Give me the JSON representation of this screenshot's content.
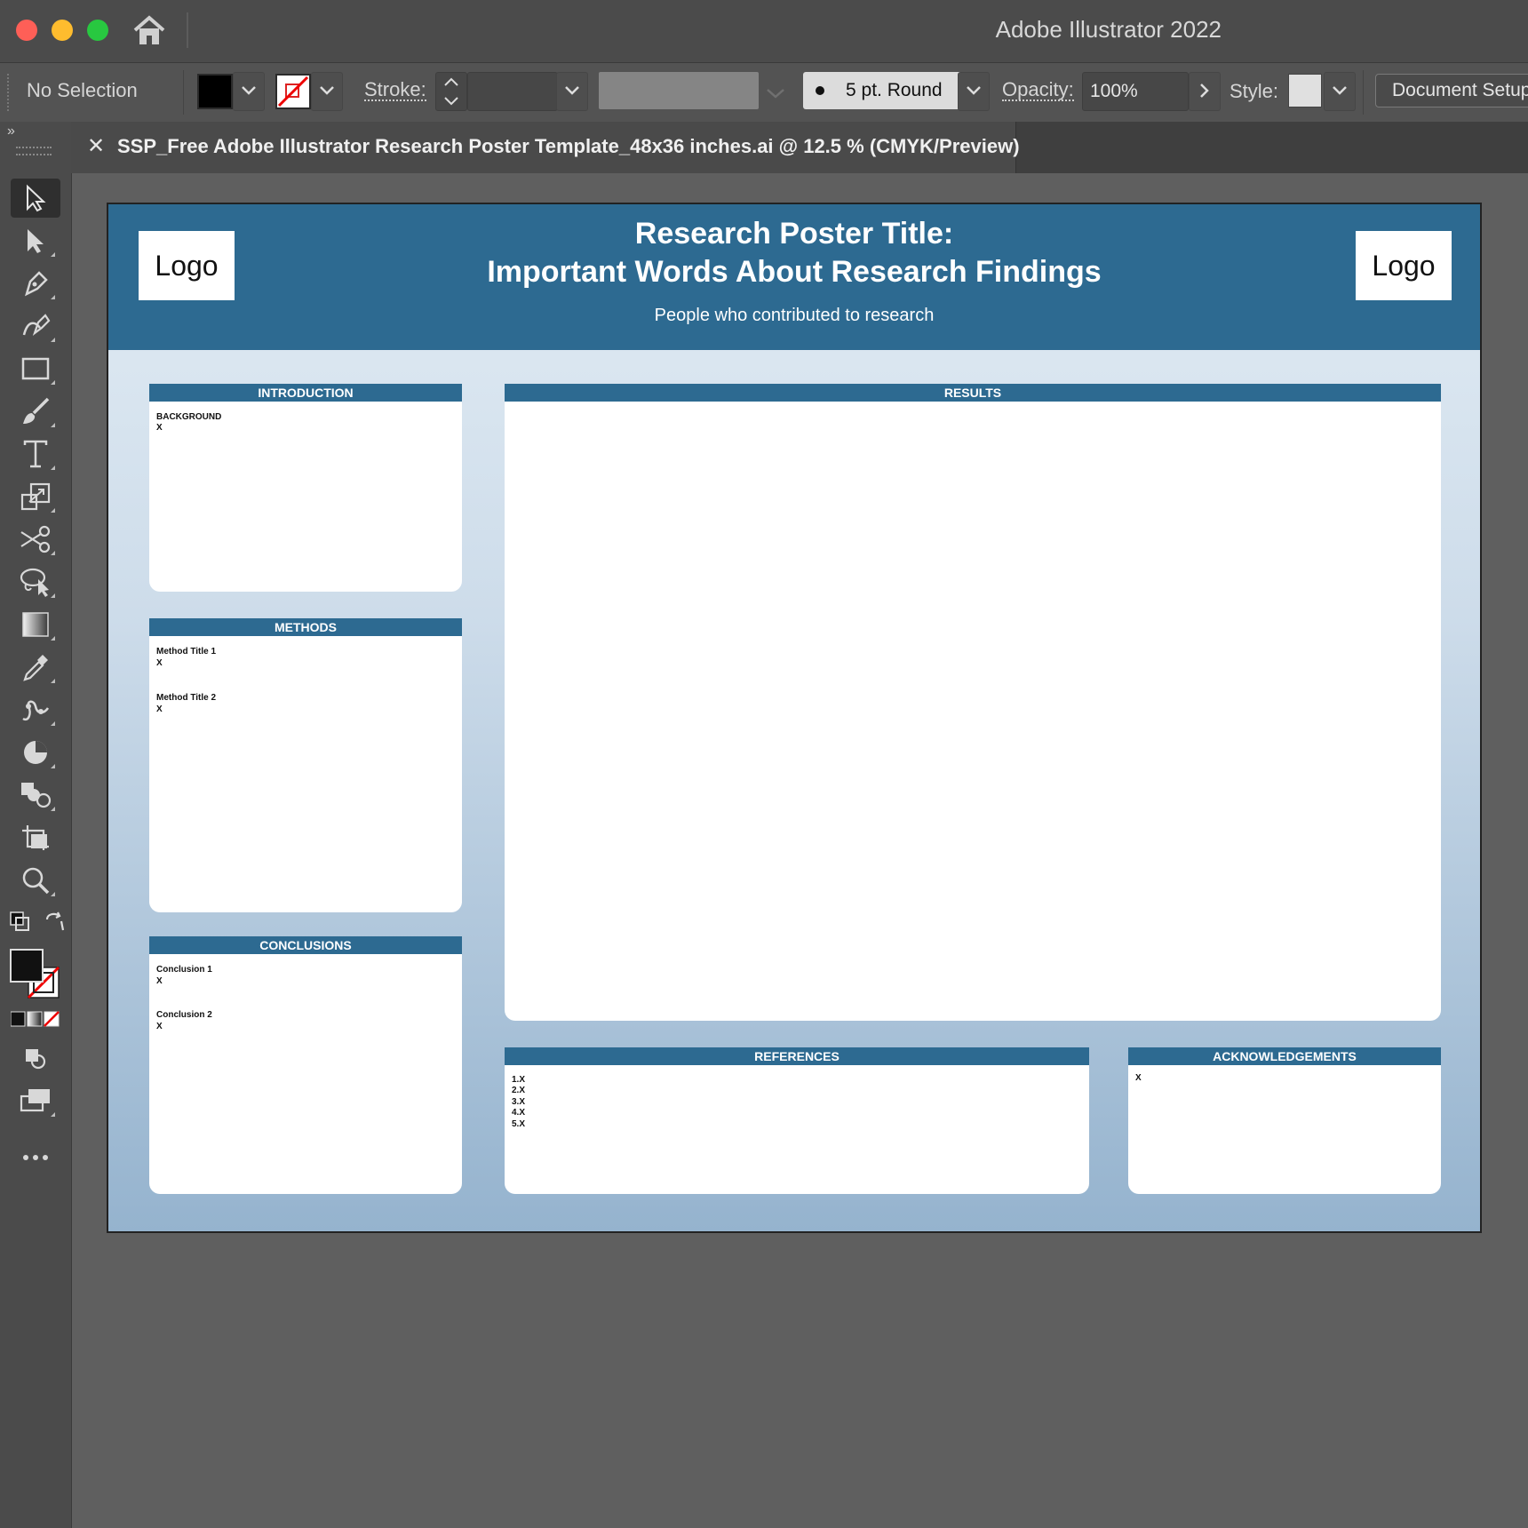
{
  "app": {
    "title": "Adobe Illustrator 2022",
    "window_controls": [
      "close",
      "minimize",
      "maximize"
    ],
    "home_icon": "home-icon"
  },
  "control_bar": {
    "selection_label": "No Selection",
    "fill_color": "#000000",
    "stroke_color": "none",
    "stroke_label": "Stroke:",
    "brush_label": "5 pt. Round",
    "opacity_label": "Opacity:",
    "opacity_value": "100%",
    "style_label": "Style:",
    "document_setup": "Document Setup"
  },
  "tools": [
    "selection-tool-icon",
    "direct-selection-tool-icon",
    "pen-tool-icon",
    "curvature-tool-icon",
    "rectangle-tool-icon",
    "paintbrush-tool-icon",
    "type-tool-icon",
    "scale-tool-icon",
    "scissors-tool-icon",
    "lasso-select-tool-icon",
    "gradient-tool-icon",
    "eyedropper-tool-icon",
    "puppet-warp-tool-icon",
    "pie-graph-tool-icon",
    "shape-builder-tool-icon",
    "artboard-tool-icon",
    "zoom-tool-icon",
    "swap-fill-stroke-icon",
    "default-colors-icon",
    "fill-stroke-swatches-icon",
    "color-mode-icons",
    "draw-mode-icon",
    "screen-mode-icon",
    "more-tools-icon"
  ],
  "document_tab": {
    "title": "SSP_Free Adobe Illustrator Research Poster Template_48x36 inches.ai @ 12.5 % (CMYK/Preview)"
  },
  "poster": {
    "colors": {
      "header": "#2d6a91",
      "panel_header": "#2d6a91"
    },
    "logo_left": "Logo",
    "logo_right": "Logo",
    "title_line1": "Research Poster Title:",
    "title_line2": "Important Words About Research Findings",
    "authors": "People who contributed to research",
    "introduction": {
      "heading": "INTRODUCTION",
      "sub": "BACKGROUND",
      "body": "X"
    },
    "methods": {
      "heading": "METHODS",
      "items": [
        {
          "title": "Method Title 1",
          "body": "X"
        },
        {
          "title": "Method Title 2",
          "body": "X"
        }
      ]
    },
    "conclusions": {
      "heading": "CONCLUSIONS",
      "items": [
        {
          "title": "Conclusion 1",
          "body": "X"
        },
        {
          "title": "Conclusion 2",
          "body": "X"
        }
      ]
    },
    "results": {
      "heading": "RESULTS"
    },
    "references": {
      "heading": "REFERENCES",
      "items": [
        "1.X",
        "2.X",
        "3.X",
        "4.X",
        "5.X"
      ]
    },
    "acknowledgements": {
      "heading": "ACKNOWLEDGEMENTS",
      "body": "X"
    }
  }
}
